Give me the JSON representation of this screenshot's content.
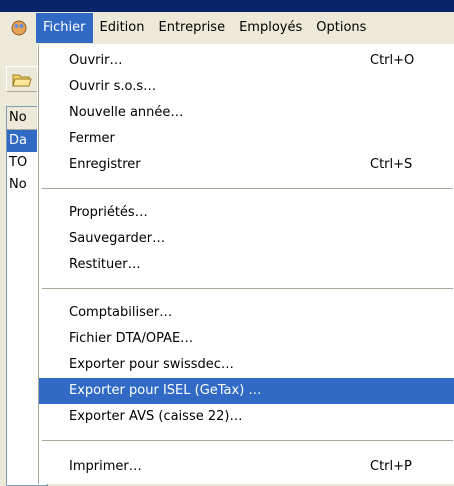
{
  "menubar": {
    "items": [
      "Fichier",
      "Edition",
      "Entreprise",
      "Employés",
      "Options"
    ]
  },
  "left_list": {
    "rows": [
      "No",
      "Da",
      "TO",
      "No"
    ]
  },
  "fichier_menu": {
    "groups": [
      [
        {
          "label": "Ouvrir…",
          "shortcut": "Ctrl+O"
        },
        {
          "label": "Ouvrir s.o.s…",
          "shortcut": ""
        },
        {
          "label": "Nouvelle année…",
          "shortcut": ""
        },
        {
          "label": "Fermer",
          "shortcut": ""
        },
        {
          "label": "Enregistrer",
          "shortcut": "Ctrl+S"
        }
      ],
      [
        {
          "label": "Propriétés…",
          "shortcut": ""
        },
        {
          "label": "Sauvegarder…",
          "shortcut": ""
        },
        {
          "label": "Restituer…",
          "shortcut": ""
        }
      ],
      [
        {
          "label": "Comptabiliser…",
          "shortcut": ""
        },
        {
          "label": "Fichier DTA/OPAE…",
          "shortcut": ""
        },
        {
          "label": "Exporter pour swissdec…",
          "shortcut": ""
        },
        {
          "label": "Exporter pour ISEL (GeTax) …",
          "shortcut": "",
          "highlighted": true
        },
        {
          "label": "Exporter AVS (caisse 22)…",
          "shortcut": ""
        }
      ],
      [
        {
          "label": "Imprimer…",
          "shortcut": "Ctrl+P"
        }
      ]
    ]
  },
  "colors": {
    "menu_highlight": "#316ac5",
    "title_blue": "#0a246a"
  },
  "icons": {
    "app": "app-logo-icon",
    "toolbar": "open-folder-icon"
  }
}
